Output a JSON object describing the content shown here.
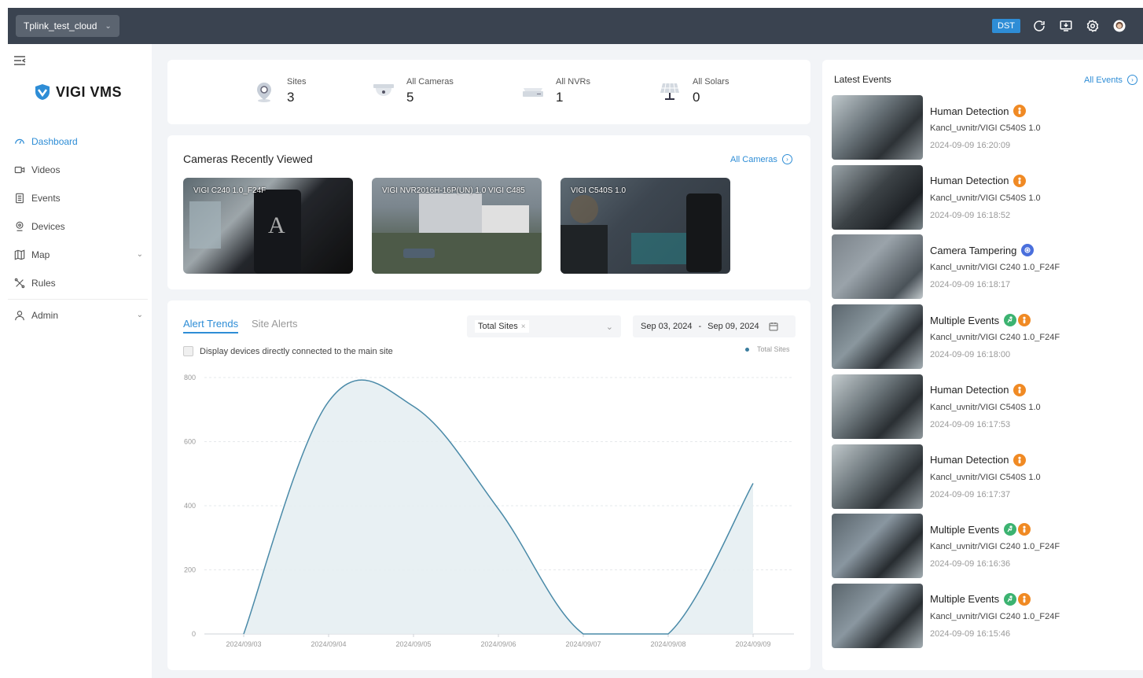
{
  "topbar": {
    "site_name": "Tplink_test_cloud",
    "dst_label": "DST"
  },
  "sidebar": {
    "logo_text": "VIGI VMS",
    "items": [
      {
        "label": "Dashboard",
        "icon": "dashboard-icon",
        "active": true
      },
      {
        "label": "Videos",
        "icon": "video-icon"
      },
      {
        "label": "Events",
        "icon": "events-icon"
      },
      {
        "label": "Devices",
        "icon": "devices-icon"
      },
      {
        "label": "Map",
        "icon": "map-icon",
        "expandable": true
      },
      {
        "label": "Rules",
        "icon": "rules-icon"
      },
      {
        "label": "Admin",
        "icon": "admin-icon",
        "expandable": true
      }
    ]
  },
  "stats": [
    {
      "label": "Sites",
      "value": "3",
      "icon": "site-pin-icon"
    },
    {
      "label": "All Cameras",
      "value": "5",
      "icon": "camera-dome-icon"
    },
    {
      "label": "All NVRs",
      "value": "1",
      "icon": "nvr-icon"
    },
    {
      "label": "All Solars",
      "value": "0",
      "icon": "solar-panel-icon"
    }
  ],
  "recent": {
    "title": "Cameras Recently Viewed",
    "all_link": "All Cameras",
    "cameras": [
      {
        "label": "VIGI C240 1.0_F24F"
      },
      {
        "label": "VIGI NVR2016H-16P(UN) 1.0 VIGI C485"
      },
      {
        "label": "VIGI C540S 1.0"
      }
    ]
  },
  "alerts": {
    "tabs": [
      "Alert Trends",
      "Site Alerts"
    ],
    "filter_chip": "Total Sites",
    "date_from": "Sep 03, 2024",
    "date_sep": "-",
    "date_to": "Sep 09, 2024",
    "checkbox_label": "Display devices directly connected to the main site",
    "legend": "Total Sites"
  },
  "chart_data": {
    "type": "area",
    "categories": [
      "2024/09/03",
      "2024/09/04",
      "2024/09/05",
      "2024/09/06",
      "2024/09/07",
      "2024/09/08",
      "2024/09/09"
    ],
    "series": [
      {
        "name": "Total Sites",
        "values": [
          0,
          725,
          710,
          390,
          0,
          0,
          470
        ]
      }
    ],
    "ylim": [
      0,
      800
    ],
    "yticks": [
      0,
      200,
      400,
      600,
      800
    ],
    "grid": true,
    "legend_position": "top-right",
    "colors": {
      "line": "#4a8aa8",
      "fill": "#e6eef2"
    }
  },
  "events": {
    "title": "Latest Events",
    "all_link": "All Events",
    "items": [
      {
        "title": "Human Detection",
        "badges": [
          "human"
        ],
        "device": "Kancl_uvnitr/VIGI C540S 1.0",
        "time": "2024-09-09 16:20:09"
      },
      {
        "title": "Human Detection",
        "badges": [
          "human"
        ],
        "device": "Kancl_uvnitr/VIGI C540S 1.0",
        "time": "2024-09-09 16:18:52"
      },
      {
        "title": "Camera Tampering",
        "badges": [
          "tamper"
        ],
        "device": "Kancl_uvnitr/VIGI C240 1.0_F24F",
        "time": "2024-09-09 16:18:17"
      },
      {
        "title": "Multiple Events",
        "badges": [
          "motion",
          "human"
        ],
        "device": "Kancl_uvnitr/VIGI C240 1.0_F24F",
        "time": "2024-09-09 16:18:00"
      },
      {
        "title": "Human Detection",
        "badges": [
          "human"
        ],
        "device": "Kancl_uvnitr/VIGI C540S 1.0",
        "time": "2024-09-09 16:17:53"
      },
      {
        "title": "Human Detection",
        "badges": [
          "human"
        ],
        "device": "Kancl_uvnitr/VIGI C540S 1.0",
        "time": "2024-09-09 16:17:37"
      },
      {
        "title": "Multiple Events",
        "badges": [
          "motion",
          "human"
        ],
        "device": "Kancl_uvnitr/VIGI C240 1.0_F24F",
        "time": "2024-09-09 16:16:36"
      },
      {
        "title": "Multiple Events",
        "badges": [
          "motion",
          "human"
        ],
        "device": "Kancl_uvnitr/VIGI C240 1.0_F24F",
        "time": "2024-09-09 16:15:46"
      }
    ]
  },
  "colors": {
    "accent": "#2e8dd6",
    "topbar": "#3a4350",
    "human_badge": "#f08a24",
    "motion_badge": "#3cb371",
    "tamper_badge": "#4a6fdc"
  }
}
